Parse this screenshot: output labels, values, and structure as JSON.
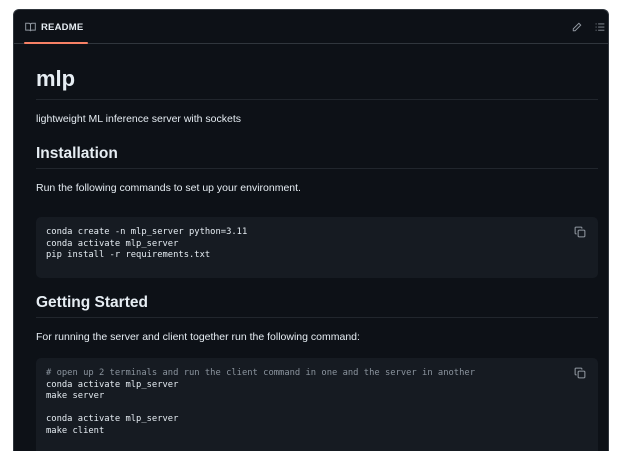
{
  "readme": {
    "tab_label": "README",
    "title": "mlp",
    "description": "lightweight ML inference server with sockets",
    "installation": {
      "heading": "Installation",
      "intro": "Run the following commands to set up your environment.",
      "code": [
        "conda create -n mlp_server python=3.11",
        "conda activate mlp_server",
        "pip install -r requirements.txt"
      ]
    },
    "getting_started": {
      "heading": "Getting Started",
      "intro": "For running the server and client together run the following command:",
      "code_comment": "# open up 2 terminals and run the client command in one and the server in another",
      "code_server": [
        "conda activate mlp_server",
        "make server"
      ],
      "code_client": [
        "conda activate mlp_server",
        "make client"
      ]
    }
  },
  "icons": {
    "tab": "book-icon",
    "edit": "pencil-icon",
    "outline": "list-icon",
    "copy": "copy-icon"
  },
  "colors": {
    "background": "#0d1117",
    "code_background": "#161b22",
    "tab_underline": "#f78166",
    "comment": "#8b949e"
  }
}
